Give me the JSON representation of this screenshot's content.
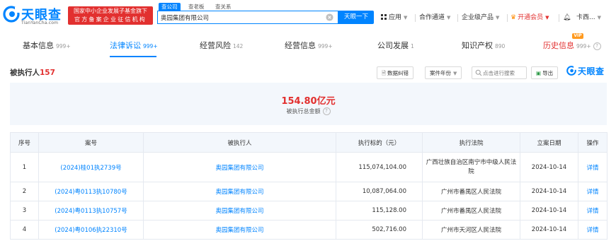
{
  "header": {
    "logo_text": "天眼查",
    "logo_sub": "TianYanCha.com",
    "gov_badge_line1": "国家中小企业发展子基金旗下",
    "gov_badge_line2": "官方备案企业征信机构",
    "search_tabs": [
      "查公司",
      "查老板",
      "查关系"
    ],
    "search_value": "奥园集团有限公司",
    "search_button": "天眼一下",
    "nav": {
      "app": "应用",
      "partner": "合作通道",
      "enterprise": "企业级产品",
      "vip": "开通会员",
      "user": "卡西..."
    }
  },
  "tabs": [
    {
      "label": "基本信息",
      "count": "999+"
    },
    {
      "label": "法律诉讼",
      "count": "999+"
    },
    {
      "label": "经营风险",
      "count": "142"
    },
    {
      "label": "经营信息",
      "count": "999+"
    },
    {
      "label": "公司发展",
      "count": "1"
    },
    {
      "label": "知识产权",
      "count": "890"
    },
    {
      "label": "历史信息",
      "count": "999+"
    }
  ],
  "vip_badge": "VIP",
  "section": {
    "title": "被执行人",
    "count": "157",
    "btn_correct": "数据纠错",
    "btn_year": "案件年份",
    "search_placeholder": "点击进行搜索",
    "btn_export": "导出",
    "logo": "天眼查"
  },
  "summary": {
    "amount": "154.80亿元",
    "label": "被执行总金额"
  },
  "table": {
    "headers": [
      "序号",
      "案号",
      "被执行人",
      "执行标的（元）",
      "执行法院",
      "立案日期",
      "操作"
    ],
    "rows": [
      {
        "no": "1",
        "case": "(2024)桂01执2739号",
        "party": "奥园集团有限公司",
        "amount": "115,074,104.00",
        "court": "广西壮族自治区南宁市中级人民法院",
        "date": "2024-10-14",
        "action": "详情"
      },
      {
        "no": "2",
        "case": "(2024)粤0113执10780号",
        "party": "奥园集团有限公司",
        "amount": "10,087,064.00",
        "court": "广州市番禺区人民法院",
        "date": "2024-10-14",
        "action": "详情"
      },
      {
        "no": "3",
        "case": "(2024)粤0113执10757号",
        "party": "奥园集团有限公司",
        "amount": "115,128.00",
        "court": "广州市番禺区人民法院",
        "date": "2024-10-14",
        "action": "详情"
      },
      {
        "no": "4",
        "case": "(2024)粤0106执22310号",
        "party": "奥园集团有限公司",
        "amount": "502,716.00",
        "court": "广州市天河区人民法院",
        "date": "2024-10-14",
        "action": "详情"
      }
    ]
  },
  "colors": {
    "brand_blue": "#0084ff",
    "accent_red": "#e2302f",
    "summary_bg": "#f3f7fc"
  }
}
